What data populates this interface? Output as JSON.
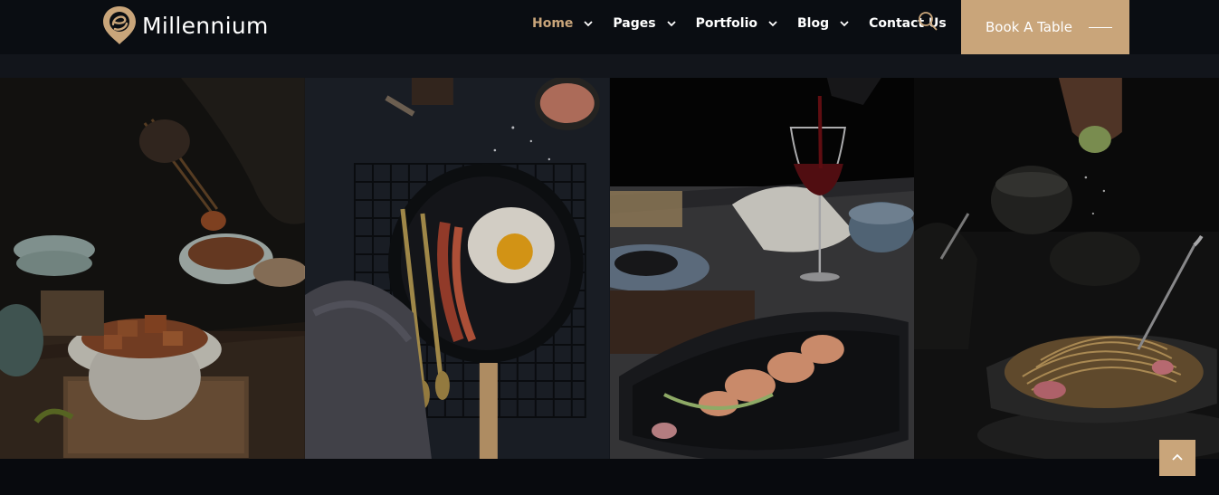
{
  "brand": {
    "name": "Millennium",
    "accent": "#c9a57a"
  },
  "nav": {
    "items": [
      {
        "label": "Home",
        "active": true,
        "has_dropdown": true
      },
      {
        "label": "Pages",
        "has_dropdown": true
      },
      {
        "label": "Portfolio",
        "has_dropdown": true
      },
      {
        "label": "Blog",
        "has_dropdown": true
      },
      {
        "label": "Contact Us",
        "has_dropdown": false
      }
    ]
  },
  "header": {
    "search_icon": "search-icon",
    "cta_label": "Book A Table"
  },
  "gallery": {
    "images": [
      {
        "name": "chopsticks-pork-bowl-photo"
      },
      {
        "name": "fried-egg-bacon-pan-photo"
      },
      {
        "name": "red-wine-prawns-plate-photo"
      },
      {
        "name": "spaghetti-bowl-photo"
      }
    ]
  },
  "scroll_top": {
    "icon": "chevron-up-icon"
  }
}
